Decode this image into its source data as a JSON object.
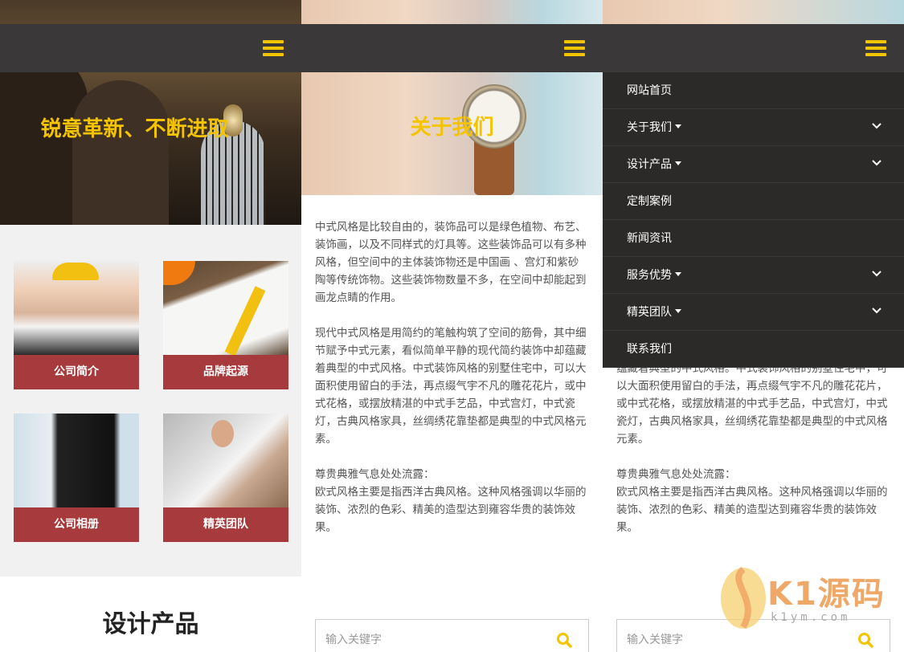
{
  "colors": {
    "accent_yellow": "#f4c400",
    "card_red": "#a73a3c",
    "header_dark": "#3a3838",
    "menu_bg": "#2b2a29"
  },
  "panel1": {
    "hero_title": "锐意革新、不断进取",
    "cards": [
      {
        "label": "公司简介"
      },
      {
        "label": "品牌起源"
      },
      {
        "label": "公司相册"
      },
      {
        "label": "精英团队"
      }
    ],
    "section_title": "设计产品"
  },
  "panel2": {
    "hero_title": "关于我们",
    "paragraphs": [
      "中式风格是比较自由的，装饰品可以是绿色植物、布艺、装饰画，以及不同样式的灯具等。这些装饰品可以有多种风格，但空间中的主体装饰物还是中国画 、宫灯和紫砂陶等传统饰物。这些装饰物数量不多，在空间中却能起到画龙点睛的作用。",
      "现代中式风格是用简约的笔触构筑了空间的筋骨，其中细节赋予中式元素，看似简单平静的现代简约装饰中却蕴藏着典型的中式风格。中式装饰风格的别墅住宅中，可以大面积使用留白的手法，再点缀气宇不凡的雕花花片，或中式花格，或摆放精湛的中式手艺品，中式宫灯，中式瓷灯，古典风格家具，丝绸绣花靠垫都是典型的中式风格元素。",
      "尊贵典雅气息处处流露：\n欧式风格主要是指西洋古典风格。这种风格强调以华丽的装饰、浓烈的色彩、精美的造型达到雍容华贵的装饰效果。"
    ],
    "search_placeholder": "输入关键字"
  },
  "panel3": {
    "menu": [
      {
        "label": "网站首页",
        "has_sub": false
      },
      {
        "label": "关于我们",
        "has_sub": true
      },
      {
        "label": "设计产品",
        "has_sub": true
      },
      {
        "label": "定制案例",
        "has_sub": false
      },
      {
        "label": "新闻资讯",
        "has_sub": false
      },
      {
        "label": "服务优势",
        "has_sub": true
      },
      {
        "label": "精英团队",
        "has_sub": true
      },
      {
        "label": "联系我们",
        "has_sub": false
      }
    ],
    "visible_text": [
      "蕴藏着典型的中式风格。中式装饰风格的别墅住宅中，可以大面积使用留白的手法，再点缀气宇不凡的雕花花片，或中式花格，或摆放精湛的中式手艺品，中式宫灯，中式瓷灯，古典风格家具，丝绸绣花靠垫都是典型的中式风格元素。",
      "尊贵典雅气息处处流露：\n欧式风格主要是指西洋古典风格。这种风格强调以华丽的装饰、浓烈的色彩、精美的造型达到雍容华贵的装饰效果。"
    ],
    "search_placeholder": "输入关键字"
  },
  "watermark": {
    "brand": "K1源码",
    "domain": "k1ym.com"
  }
}
